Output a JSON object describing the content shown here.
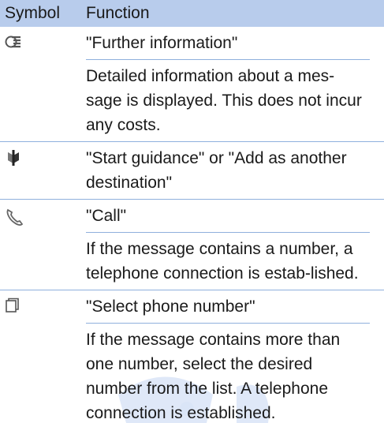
{
  "header": {
    "symbol": "Symbol",
    "function": "Function"
  },
  "rows": [
    {
      "icon": "info-list-icon",
      "title": "\"Further information\"",
      "description": "Detailed information about a mes-sage is displayed. This does not incur any costs."
    },
    {
      "icon": "destination-flag-icon",
      "title": "\"Start guidance\" or \"Add as another destination\"",
      "description": ""
    },
    {
      "icon": "phone-handset-icon",
      "title": "\"Call\"",
      "description": "If the message contains a number, a telephone connection is estab-lished."
    },
    {
      "icon": "phone-number-select-icon",
      "title": "\"Select phone number\"",
      "description": "If the message contains more than one number, select the desired number from the list. A telephone connection is established."
    }
  ],
  "colors": {
    "header_bg": "#b8ccec",
    "rule": "#8fb0dd",
    "watermark": "#c9daf3"
  }
}
